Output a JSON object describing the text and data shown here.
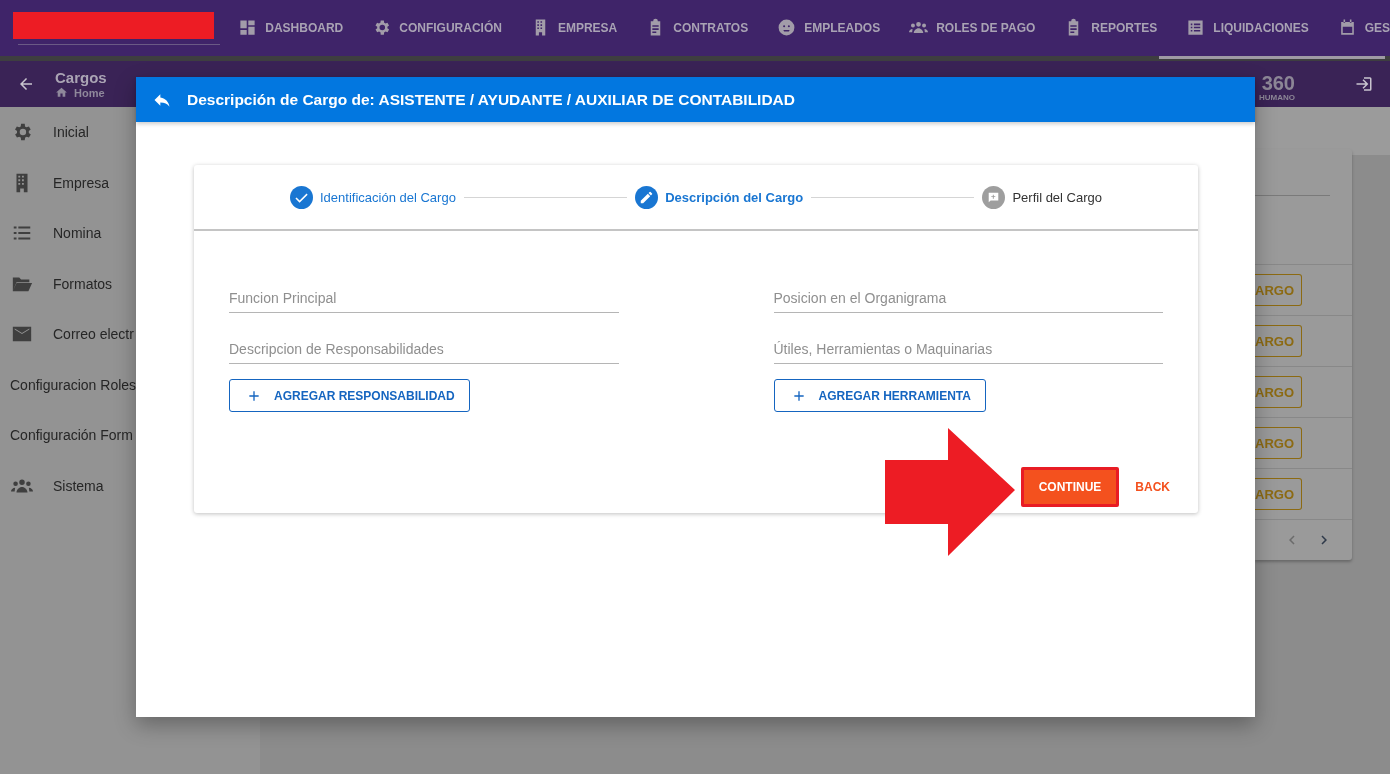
{
  "nav": [
    {
      "label": "DASHBOARD"
    },
    {
      "label": "CONFIGURACIÓN"
    },
    {
      "label": "EMPRESA"
    },
    {
      "label": "CONTRATOS"
    },
    {
      "label": "EMPLEADOS"
    },
    {
      "label": "ROLES DE PAGO"
    },
    {
      "label": "REPORTES"
    },
    {
      "label": "LIQUIDACIONES"
    },
    {
      "label": "GES"
    }
  ],
  "subheader": {
    "title": "Cargos",
    "breadcrumb": "Home",
    "logo_number": "360",
    "logo_subtitle": "HUMANO"
  },
  "sidebar": [
    {
      "label": "Inicial"
    },
    {
      "label": "Empresa"
    },
    {
      "label": "Nomina"
    },
    {
      "label": "Formatos"
    },
    {
      "label": "Correo electr"
    },
    {
      "label": "Configuracion Roles"
    },
    {
      "label": "Configuración Form"
    },
    {
      "label": "Sistema"
    }
  ],
  "background_table": {
    "row_buttons": [
      "ARGO",
      "ARGO",
      "ARGO",
      "ARGO",
      "ARGO"
    ]
  },
  "dialog": {
    "title": "Descripción de Cargo de: ASISTENTE / AYUDANTE / AUXILIAR DE CONTABILIDAD",
    "steps": [
      {
        "label": "Identificación del Cargo",
        "kind": "done",
        "selected": false
      },
      {
        "label": "Descripción del Cargo",
        "kind": "edit",
        "selected": true
      },
      {
        "label": "Perfil del Cargo",
        "kind": "pending",
        "selected": false
      }
    ],
    "columns": [
      {
        "fields": [
          {
            "placeholder": "Funcion Principal"
          },
          {
            "placeholder": "Descripcion de Responsabilidades"
          }
        ],
        "add_button": "AGREGAR RESPONSABILIDAD"
      },
      {
        "fields": [
          {
            "placeholder": "Posicion en el Organigrama"
          },
          {
            "placeholder": "Útiles, Herramientas o Maquinarias"
          }
        ],
        "add_button": "AGREGAR HERRAMIENTA"
      }
    ],
    "continue_button": {
      "label": "CONTINUE",
      "highlighted": true
    },
    "back_button": {
      "label": "BACK"
    }
  }
}
